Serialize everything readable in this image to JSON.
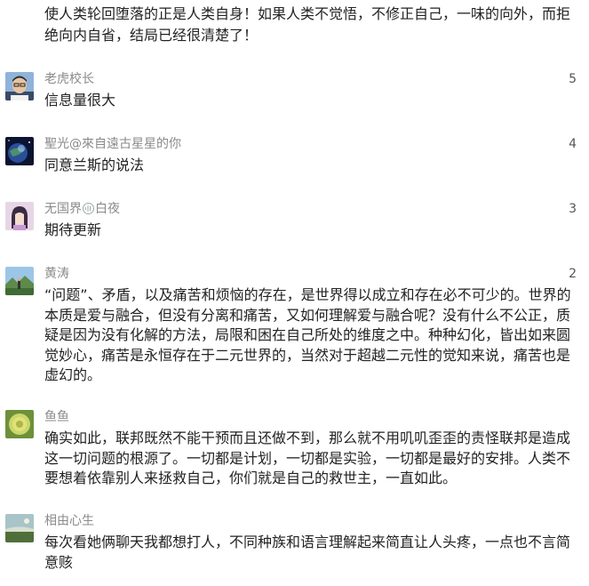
{
  "top_comment_tail": "使人类轮回堕落的正是人类自身！如果人类不觉悟，不修正自己，一味的向外，而拒绝向内自省，结局已经很清楚了！",
  "comments": [
    {
      "user": "老虎校长",
      "likes": "5",
      "text": "信息量很大",
      "avatar": "avatar-man-glasses"
    },
    {
      "user": "聖光@來自遠古星星的你",
      "likes": "4",
      "text": "同意兰斯的说法",
      "avatar": "avatar-planet"
    },
    {
      "user_pre": "无国界",
      "user_post": "白夜",
      "likes": "3",
      "text": "期待更新",
      "avatar": "avatar-girl"
    },
    {
      "user": "黄涛",
      "likes": "2",
      "text": "“问题”、矛盾，以及痛苦和烦恼的存在，是世界得以成立和存在必不可少的。世界的本质是爱与融合，但没有分离和痛苦，又如何理解爱与融合呢？没有什么不公正，质疑是因为没有化解的方法，局限和困在自己所处的维度之中。种种幻化，皆出如来圆觉妙心，痛苦是永恒存在于二元世界的，当然对于超越二元性的觉知来说，痛苦也是虚幻的。",
      "avatar": "avatar-landscape"
    },
    {
      "user": "鱼鱼",
      "likes": "",
      "text": "确实如此，联邦既然不能干预而且还做不到，那么就不用叽叽歪歪的责怪联邦是造成这一切问题的根源了。一切都是计划，一切都是实验，一切都是最好的安排。人类不要想着依靠别人来拯救自己，你们就是自己的救世主，一直如此。",
      "avatar": "avatar-flower"
    },
    {
      "user": "相由心生",
      "likes": "",
      "text": "每次看她俩聊天我都想打人，不同种族和语言理解起来简直让人头疼，一点也不言简意赅",
      "avatar": "avatar-nature"
    }
  ]
}
